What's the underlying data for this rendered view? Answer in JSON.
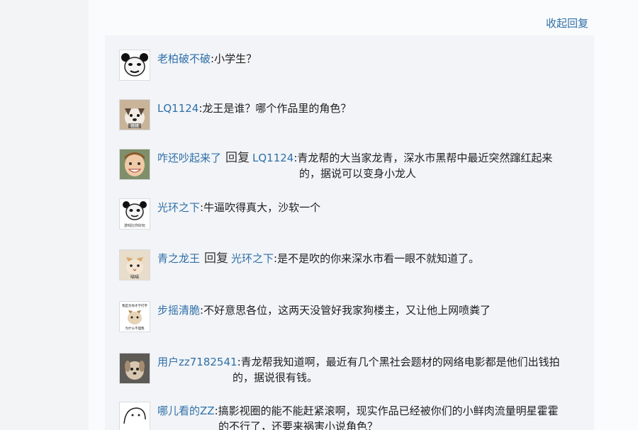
{
  "header": {
    "collapse_label": "收起回复"
  },
  "replies": [
    {
      "user": "老柏破不破",
      "sep": ":",
      "text": "小学生？"
    },
    {
      "user": "LQ1124",
      "sep": ":",
      "text": "龙王是谁？哪个作品里的角色？"
    },
    {
      "user": "咋还吵起来了",
      "reply_word": "回复",
      "target": "LQ1124",
      "sep": ":",
      "text": "青龙帮的大当家龙青，深水市黑帮中最近突然蹿红起来",
      "text2": "的，据说可以变身小龙人"
    },
    {
      "user": "光环之下",
      "sep": ":",
      "text": "牛逼吹得真大，沙软一个"
    },
    {
      "user": "青之龙王",
      "reply_word": "回复",
      "target": "光环之下",
      "sep": ":",
      "text": "是不是吹的你来深水市看一眼不就知道了。"
    },
    {
      "user": "步摇清脆",
      "sep": ":",
      "text": "不好意思各位，这两天没管好我家狗楼主，又让他上网喷粪了"
    },
    {
      "user": "用户zz7182541",
      "sep": ":",
      "text": "青龙帮我知道啊，最近有几个黑社会题材的网络电影都是他们出钱拍",
      "text2": "的，据说很有钱。"
    },
    {
      "user": "哪儿看的ZZ",
      "sep": ":",
      "text": "搞影视圈的能不能赶紧滚啊，现实作品已经被你们的小鲜肉流量明星霍霍",
      "text2": "的不行了，还要来祸害小说角色？"
    }
  ],
  "avatar_captions": {
    "r2": "猪猪",
    "r4": "游戏比你好玩",
    "r5": "喵喵",
    "r6_top": "我是为你才学打字",
    "r6_bottom": "为什么不理我"
  }
}
